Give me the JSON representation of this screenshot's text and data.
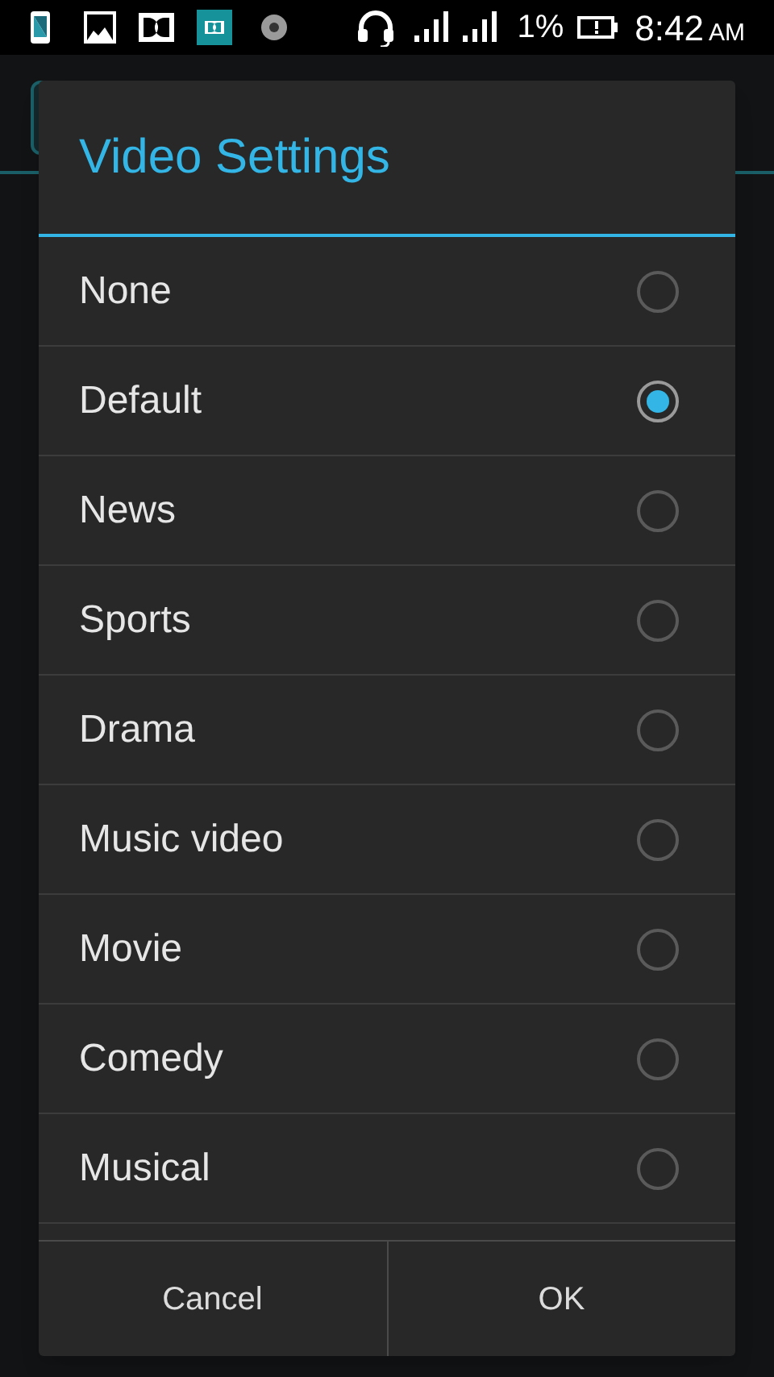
{
  "status_bar": {
    "battery_text": "1%",
    "time": "8:42",
    "ampm": "AM"
  },
  "dialog": {
    "title": "Video Settings",
    "options": [
      {
        "label": "None",
        "selected": false
      },
      {
        "label": "Default",
        "selected": true
      },
      {
        "label": "News",
        "selected": false
      },
      {
        "label": "Sports",
        "selected": false
      },
      {
        "label": "Drama",
        "selected": false
      },
      {
        "label": "Music video",
        "selected": false
      },
      {
        "label": "Movie",
        "selected": false
      },
      {
        "label": "Comedy",
        "selected": false
      },
      {
        "label": "Musical",
        "selected": false
      }
    ],
    "buttons": [
      "Cancel",
      "OK"
    ]
  }
}
